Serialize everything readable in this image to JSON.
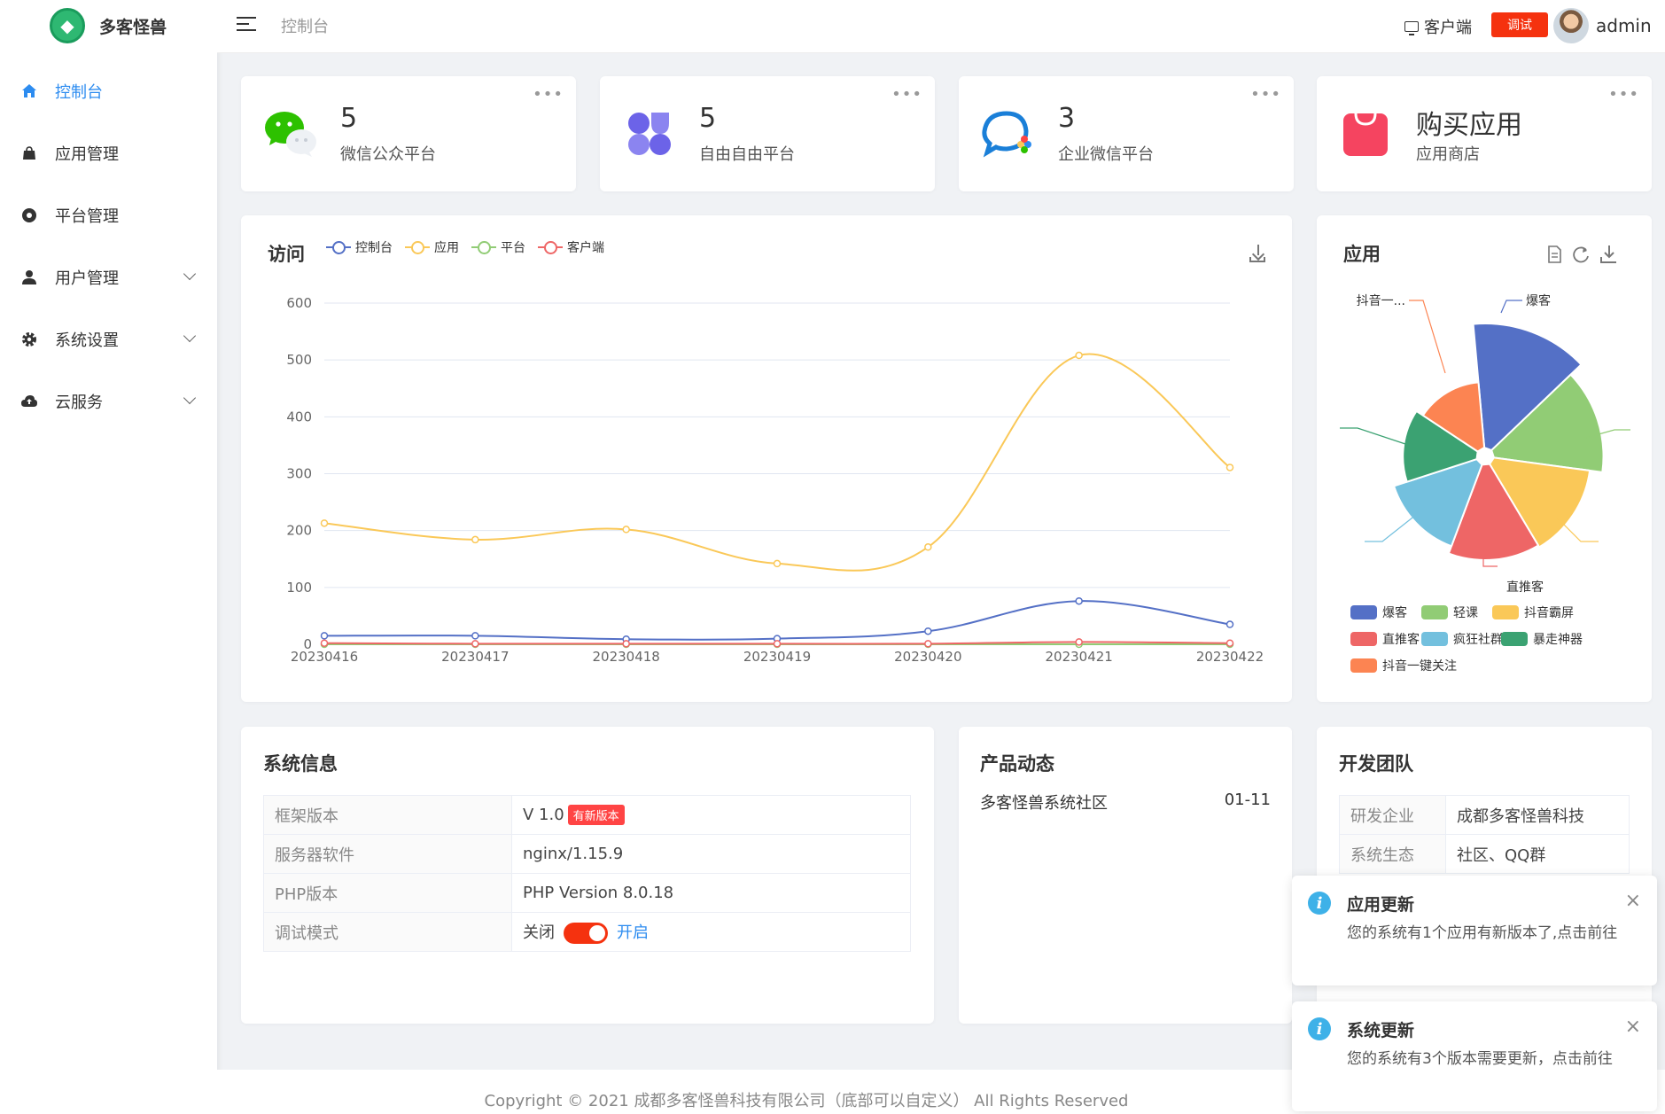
{
  "app": {
    "name": "多客怪兽"
  },
  "sidebar": {
    "items": [
      {
        "label": "控制台",
        "icon": "home-icon",
        "active": true
      },
      {
        "label": "应用管理",
        "icon": "bag-icon"
      },
      {
        "label": "平台管理",
        "icon": "aperture-icon"
      },
      {
        "label": "用户管理",
        "icon": "user-icon",
        "has_children": true
      },
      {
        "label": "系统设置",
        "icon": "gear-icon",
        "has_children": true
      },
      {
        "label": "云服务",
        "icon": "cloud-upload-icon",
        "has_children": true
      }
    ]
  },
  "header": {
    "breadcrumb": "控制台",
    "client_label": "客户端",
    "debug_label": "调试",
    "user_name": "admin"
  },
  "stats": [
    {
      "value": "5",
      "label": "微信公众平台",
      "icon": "wechat-icon"
    },
    {
      "value": "5",
      "label": "自由自由平台",
      "icon": "apps-grid-icon"
    },
    {
      "value": "3",
      "label": "企业微信平台",
      "icon": "wecom-icon"
    },
    {
      "value": "购买应用",
      "label": "应用商店",
      "icon": "shopping-bag-icon"
    }
  ],
  "visit_chart": {
    "title": "访问",
    "chart_data": {
      "type": "line",
      "x": [
        "20230416",
        "20230417",
        "20230418",
        "20230419",
        "20230420",
        "20230421",
        "20230422"
      ],
      "ylim": [
        0,
        600
      ],
      "yticks": [
        "0",
        "100",
        "200",
        "300",
        "400",
        "500",
        "600"
      ],
      "grid": true,
      "legend_position": "top-left",
      "series": [
        {
          "name": "控制台",
          "color": "#5470c6",
          "values": [
            15,
            15,
            9,
            10,
            23,
            76,
            35
          ]
        },
        {
          "name": "应用",
          "color": "#fac858",
          "values": [
            213,
            184,
            202,
            142,
            171,
            508,
            311
          ]
        },
        {
          "name": "平台",
          "color": "#91cc75",
          "values": [
            0,
            0,
            0,
            0,
            0,
            0,
            0
          ]
        },
        {
          "name": "客户端",
          "color": "#ee6666",
          "values": [
            2,
            1,
            1,
            1,
            1,
            4,
            2
          ]
        }
      ]
    }
  },
  "app_chart": {
    "title": "应用",
    "chart_data": {
      "type": "pie",
      "rose": true,
      "legend_position": "bottom",
      "slices": [
        {
          "name": "爆客",
          "color": "#5470c6",
          "value": 100
        },
        {
          "name": "轻课",
          "color": "#91cc75",
          "value": 85
        },
        {
          "name": "抖音霸屏",
          "color": "#fac858",
          "value": 72
        },
        {
          "name": "直推客",
          "color": "#ee6666",
          "value": 70
        },
        {
          "name": "疯狂社群",
          "color": "#73c0de",
          "value": 62
        },
        {
          "name": "暴走神器",
          "color": "#3ba272",
          "value": 48
        },
        {
          "name": "抖音一键关注",
          "color": "#fc8452",
          "value": 40
        }
      ],
      "callout_labels": [
        "爆客",
        "抖音一...",
        "直推客"
      ]
    }
  },
  "system_info": {
    "title": "系统信息",
    "rows": [
      {
        "key": "框架版本",
        "value": "V 1.0",
        "badge": "有新版本"
      },
      {
        "key": "服务器软件",
        "value": "nginx/1.15.9"
      },
      {
        "key": "PHP版本",
        "value": "PHP Version 8.0.18"
      },
      {
        "key": "调试模式",
        "off_label": "关闭",
        "on_label": "开启"
      }
    ]
  },
  "product_news": {
    "title": "产品动态",
    "items": [
      {
        "text": "多客怪兽系统社区",
        "date": "01-11"
      }
    ]
  },
  "dev_team": {
    "title": "开发团队",
    "rows": [
      {
        "key": "研发企业",
        "value": "成都多客怪兽科技"
      },
      {
        "key": "系统生态",
        "value": "社区、QQ群"
      }
    ]
  },
  "notifications": [
    {
      "title": "应用更新",
      "text": "您的系统有1个应用有新版本了,点击前往"
    },
    {
      "title": "系统更新",
      "text": "您的系统有3个版本需要更新，点击前往"
    }
  ],
  "footer": {
    "text": "Copyright © 2021 成都多客怪兽科技有限公司（底部可以自定义）  All Rights Reserved"
  }
}
